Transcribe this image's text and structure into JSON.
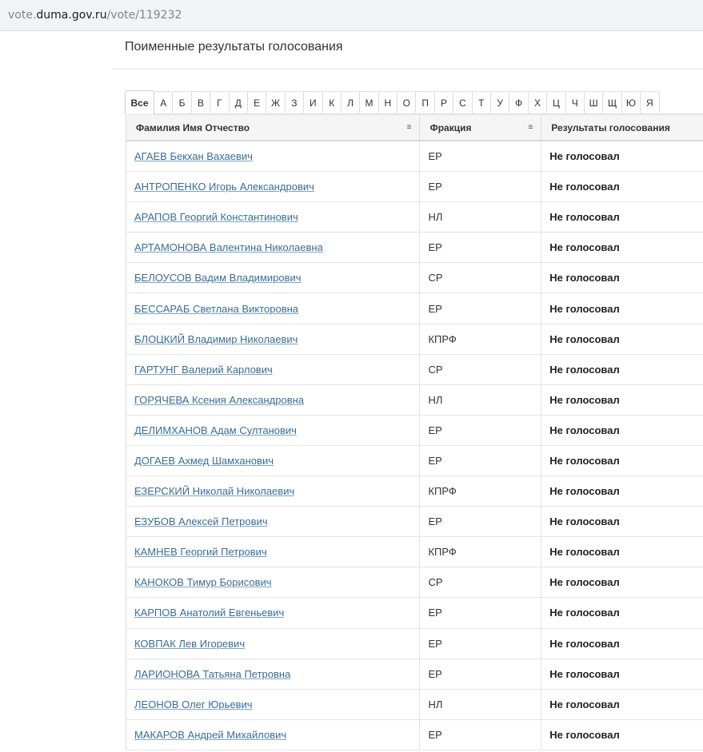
{
  "browser": {
    "url_prefix": "vote.",
    "url_host": "duma.gov.ru",
    "url_path": "/vote/119232"
  },
  "page": {
    "title": "Поименные результаты голосования"
  },
  "letters": [
    "Все",
    "А",
    "Б",
    "В",
    "Г",
    "Д",
    "Е",
    "Ж",
    "З",
    "И",
    "К",
    "Л",
    "М",
    "Н",
    "О",
    "П",
    "Р",
    "С",
    "Т",
    "У",
    "Ф",
    "Х",
    "Ц",
    "Ч",
    "Ш",
    "Щ",
    "Ю",
    "Я"
  ],
  "table": {
    "columns": {
      "name": "Фамилия Имя Отчество",
      "faction": "Фракция",
      "result": "Результаты голосования"
    },
    "rows": [
      {
        "name": "АГАЕВ Бекхан Вахаевич",
        "faction": "ЕР",
        "result": "Не голосовал"
      },
      {
        "name": "АНТРОПЕНКО Игорь Александрович",
        "faction": "ЕР",
        "result": "Не голосовал"
      },
      {
        "name": "АРАПОВ Георгий Константинович",
        "faction": "НЛ",
        "result": "Не голосовал"
      },
      {
        "name": "АРТАМОНОВА Валентина Николаевна",
        "faction": "ЕР",
        "result": "Не голосовал"
      },
      {
        "name": "БЕЛОУСОВ Вадим Владимирович",
        "faction": "СР",
        "result": "Не голосовал"
      },
      {
        "name": "БЕССАРАБ Светлана Викторовна",
        "faction": "ЕР",
        "result": "Не голосовал"
      },
      {
        "name": "БЛОЦКИЙ Владимир Николаевич",
        "faction": "КПРФ",
        "result": "Не голосовал"
      },
      {
        "name": "ГАРТУНГ Валерий Карлович",
        "faction": "СР",
        "result": "Не голосовал"
      },
      {
        "name": "ГОРЯЧЕВА Ксения Александровна",
        "faction": "НЛ",
        "result": "Не голосовал"
      },
      {
        "name": "ДЕЛИМХАНОВ Адам Султанович",
        "faction": "ЕР",
        "result": "Не голосовал"
      },
      {
        "name": "ДОГАЕВ Ахмед Шамханович",
        "faction": "ЕР",
        "result": "Не голосовал"
      },
      {
        "name": "ЕЗЕРСКИЙ Николай Николаевич",
        "faction": "КПРФ",
        "result": "Не голосовал"
      },
      {
        "name": "ЕЗУБОВ Алексей Петрович",
        "faction": "ЕР",
        "result": "Не голосовал"
      },
      {
        "name": "КАМНЕВ Георгий Петрович",
        "faction": "КПРФ",
        "result": "Не голосовал"
      },
      {
        "name": "КАНОКОВ Тимур Борисович",
        "faction": "СР",
        "result": "Не голосовал"
      },
      {
        "name": "КАРПОВ Анатолий Евгеньевич",
        "faction": "ЕР",
        "result": "Не голосовал"
      },
      {
        "name": "КОВПАК Лев Игоревич",
        "faction": "ЕР",
        "result": "Не голосовал"
      },
      {
        "name": "ЛАРИОНОВА Татьяна Петровна",
        "faction": "ЕР",
        "result": "Не голосовал"
      },
      {
        "name": "ЛЕОНОВ Олег Юрьевич",
        "faction": "НЛ",
        "result": "Не голосовал"
      },
      {
        "name": "МАКАРОВ Андрей Михайлович",
        "faction": "ЕР",
        "result": "Не голосовал"
      }
    ]
  }
}
